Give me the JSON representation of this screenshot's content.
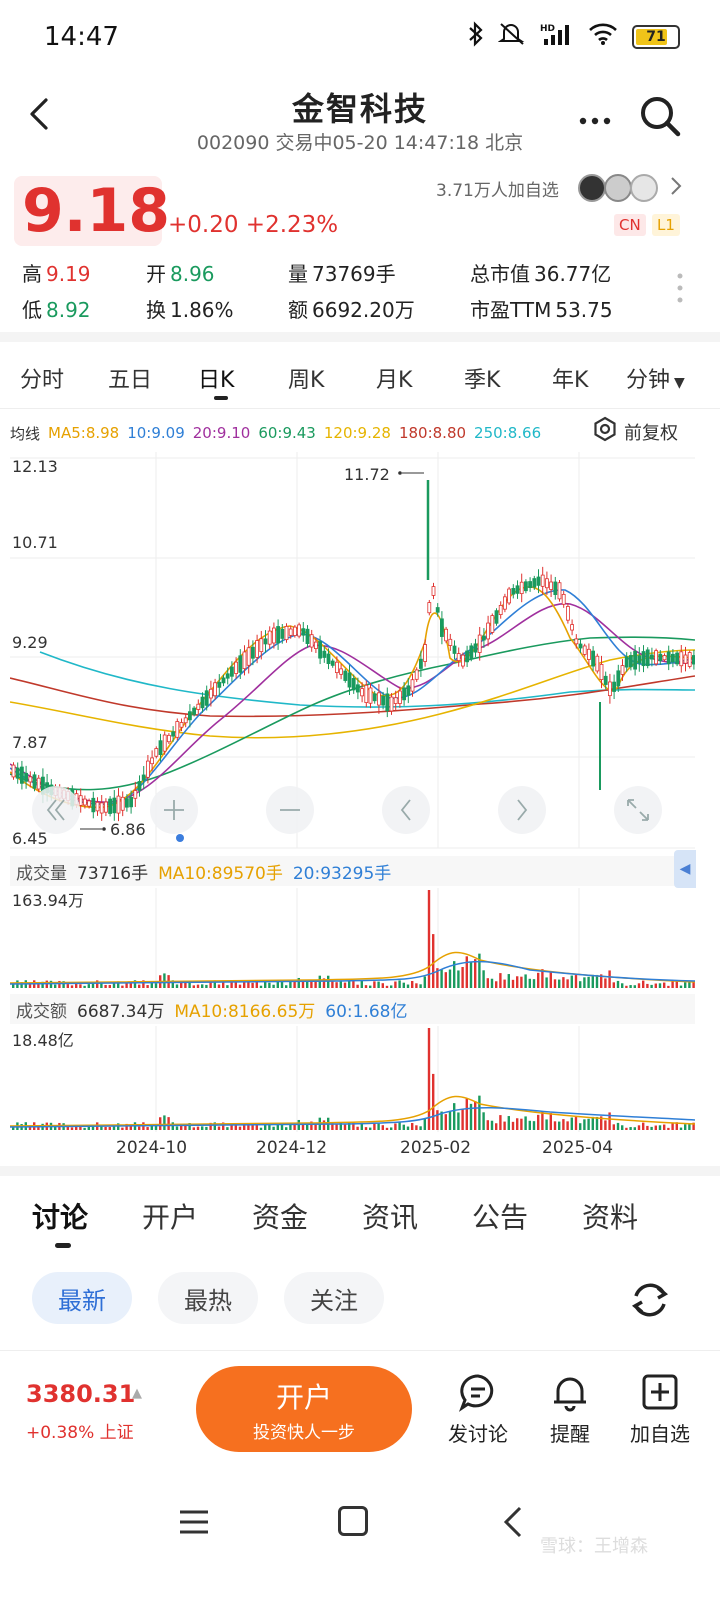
{
  "status_bar": {
    "time": "14:47",
    "battery": "71",
    "battery_level": 0.71,
    "network": "HD"
  },
  "header": {
    "title": "金智科技",
    "subtitle": "002090 交易中05-20 14:47:18 北京"
  },
  "quote": {
    "price": "9.18",
    "change": "+0.20 +2.23%",
    "watch_count": "3.71万人加自选",
    "badge_cn": "CN",
    "badge_l1": "L1",
    "stats": {
      "high_label": "高",
      "high": "9.19",
      "open_label": "开",
      "open": "8.96",
      "volume_label": "量",
      "volume": "73769手",
      "market_cap_label": "总市值",
      "market_cap": "36.77亿",
      "low_label": "低",
      "low": "8.92",
      "turnover_label": "换",
      "turnover": "1.86%",
      "amount_label": "额",
      "amount": "6692.20万",
      "pe_label": "市盈TTM",
      "pe": "53.75"
    }
  },
  "period_tabs": [
    "分时",
    "五日",
    "日K",
    "周K",
    "月K",
    "季K",
    "年K",
    "分钟"
  ],
  "period_active": "日K",
  "ma_legend": {
    "label": "均线",
    "items": [
      {
        "text": "MA5:8.98",
        "color": "#e6a100"
      },
      {
        "text": "10:9.09",
        "color": "#2f7fd6"
      },
      {
        "text": "20:9.10",
        "color": "#a0309e"
      },
      {
        "text": "60:9.43",
        "color": "#1a9a5e"
      },
      {
        "text": "120:9.28",
        "color": "#e6b400"
      },
      {
        "text": "180:8.80",
        "color": "#c0392b"
      },
      {
        "text": "250:8.66",
        "color": "#20b8c8"
      }
    ],
    "adjust_label": "前复权"
  },
  "kline": {
    "y_ticks": [
      "12.13",
      "10.71",
      "9.29",
      "7.87",
      "6.45"
    ],
    "max_label": "11.72",
    "min_label": "6.86"
  },
  "volume_panel": {
    "label": "成交量",
    "value": "73716手",
    "ma10": "MA10:89570手",
    "ma20": "20:93295手",
    "axis_max": "163.94万"
  },
  "amount_panel": {
    "label": "成交额",
    "value": "6687.34万",
    "ma10": "MA10:8166.65万",
    "ma60": "60:1.68亿",
    "axis_max": "18.48亿"
  },
  "date_axis": [
    "2024-10",
    "2024-12",
    "2025-02",
    "2025-04"
  ],
  "content_tabs": [
    "讨论",
    "开户",
    "资金",
    "资讯",
    "公告",
    "资料"
  ],
  "content_active": "讨论",
  "filter_chips": [
    "最新",
    "最热",
    "关注"
  ],
  "bottom_bar": {
    "index_value": "3380.31",
    "index_change": "+0.38% 上证",
    "open_account_label": "开户",
    "open_account_sub": "投资快人一步",
    "discuss_label": "发讨论",
    "alert_label": "提醒",
    "add_watch_label": "加自选"
  },
  "watermark": "雪球：王增森"
}
